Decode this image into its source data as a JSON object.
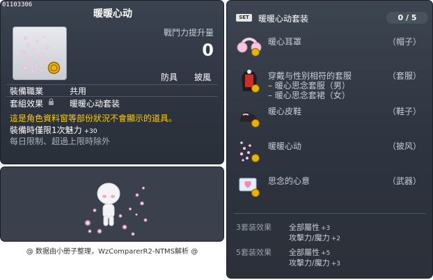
{
  "item": {
    "id": "01103306",
    "name": "暖暖心动",
    "power_label": "戰鬥力提升量",
    "power_value": "0",
    "tags": [
      "防具",
      "披風"
    ],
    "job_label": "裝備職業",
    "job_value": "共用",
    "set_label": "套組效果",
    "set_value": "暖暖心动套装",
    "notice": "這是角色資料窗等部份狀況不會顯示的道具。",
    "charm_text": "裝備時僅限1次魅力",
    "charm_value": "+30",
    "limit_text": "每日限制、超過上限時除外"
  },
  "footer": {
    "credit": "@ 数据由小册子整理，WzComparerR2-NTMS解析 @"
  },
  "set": {
    "badge": "SET",
    "name": "暖暖心动套装",
    "count": "0 / 5",
    "pieces": [
      {
        "name": "暖心耳罩",
        "slot": "（帽子）",
        "icon": "earmuff-icon"
      },
      {
        "name": "穿戴与性别相符的套服",
        "slot": "（套服）",
        "icon": "outfit-icon",
        "sub": [
          "– 暖心思念套服（男）",
          "– 暖心思念套裙（女）"
        ]
      },
      {
        "name": "暖心皮鞋",
        "slot": "（鞋子）",
        "icon": "shoes-icon"
      },
      {
        "name": "暖暖心动",
        "slot": "（披风）",
        "icon": "sparkle-cape-icon"
      },
      {
        "name": "思念的心意",
        "slot": "（武器）",
        "icon": "heart-letter-icon"
      }
    ],
    "effects": [
      {
        "label": "3套装效果",
        "stats": [
          {
            "text": "全部屬性",
            "value": "+3"
          },
          {
            "text": "攻擊力/魔力",
            "value": "+2"
          }
        ]
      },
      {
        "label": "5套装效果",
        "stats": [
          {
            "text": "全部屬性",
            "value": "+5"
          },
          {
            "text": "攻擊力/魔力",
            "value": "+3"
          }
        ]
      }
    ]
  },
  "colors": {
    "panel": "#2e3440",
    "notice": "#ffcc00",
    "sparkle": "#ff9fd6",
    "coin": "#e8b400"
  }
}
